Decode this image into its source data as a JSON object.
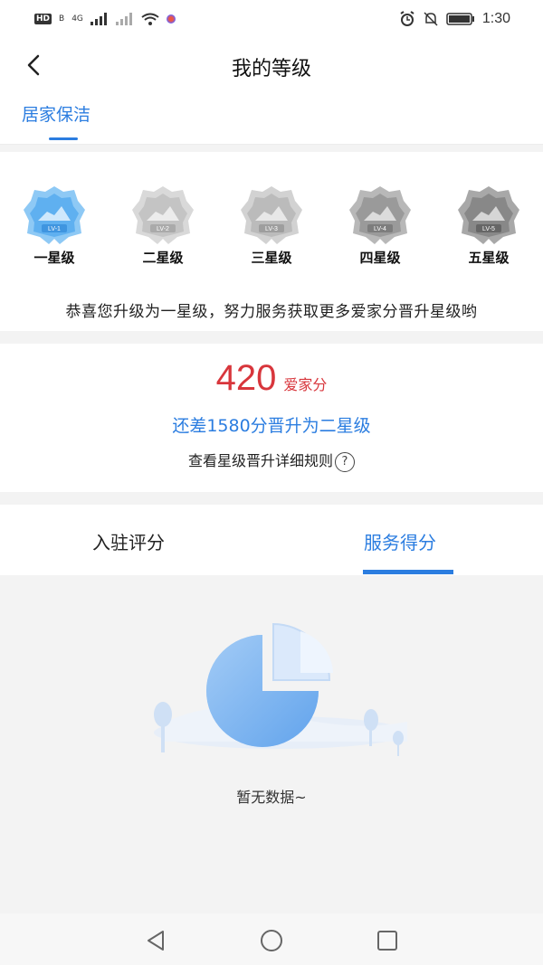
{
  "status_bar": {
    "hd": "HD",
    "carrier": "B",
    "network": "4G",
    "time": "1:30"
  },
  "header": {
    "title": "我的等级",
    "back_icon": "back-arrow-icon"
  },
  "category_tab": {
    "label": "居家保洁"
  },
  "levels": [
    {
      "label": "一星级",
      "badge_text": "LV-1",
      "active": true
    },
    {
      "label": "二星级",
      "badge_text": "LV-2",
      "active": false
    },
    {
      "label": "三星级",
      "badge_text": "LV-3",
      "active": false
    },
    {
      "label": "四星级",
      "badge_text": "LV-4",
      "active": false
    },
    {
      "label": "五星级",
      "badge_text": "LV-5",
      "active": false
    }
  ],
  "congrats_text": "恭喜您升级为一星级，努力服务获取更多爱家分晋升星级哟",
  "score": {
    "value": "420",
    "unit": "爱家分",
    "need_text": "还差1580分晋升为二星级",
    "rules_link": "查看星级晋升详细规则"
  },
  "subtabs": {
    "tab1": "入驻评分",
    "tab2": "服务得分",
    "active": "tab2"
  },
  "empty_state": {
    "text": "暂无数据~"
  },
  "colors": {
    "accent": "#2b7de0",
    "score_red": "#d8363c",
    "background": "#f3f3f3"
  }
}
